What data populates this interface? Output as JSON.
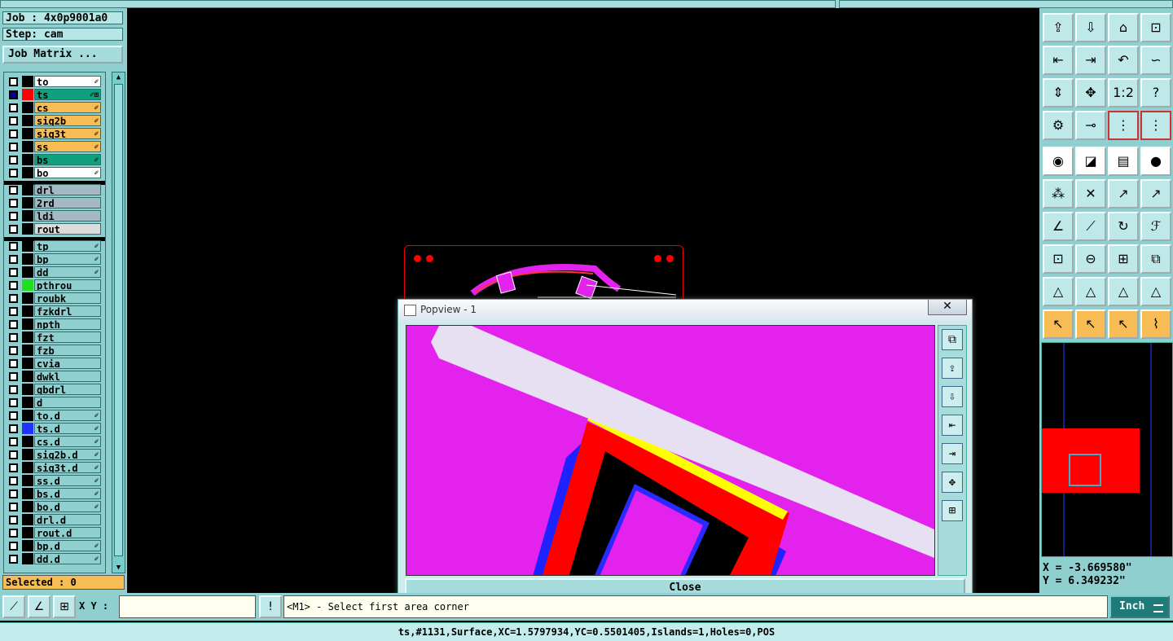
{
  "job_label": "Job : 4x0p9001a0",
  "step_label": "Step: cam",
  "job_matrix_button": "Job Matrix ...",
  "layers": [
    {
      "name": "to",
      "color": "#ffffff",
      "swatch": "#000000",
      "icon": "✐"
    },
    {
      "name": "ts",
      "color": "#0fa07e",
      "swatch": "#ff0000",
      "icon": "✐⊞",
      "checkbox_color": "#0000aa"
    },
    {
      "name": "cs",
      "color": "#f7bd54",
      "swatch": "#000000",
      "icon": "✐"
    },
    {
      "name": "sig2b",
      "color": "#f7bd54",
      "swatch": "#000000",
      "icon": "✐"
    },
    {
      "name": "sig3t",
      "color": "#f7bd54",
      "swatch": "#000000",
      "icon": "✐"
    },
    {
      "name": "ss",
      "color": "#f7bd54",
      "swatch": "#000000",
      "icon": "✐"
    },
    {
      "name": "bs",
      "color": "#0fa07e",
      "swatch": "#000000",
      "icon": "✐"
    },
    {
      "name": "bo",
      "color": "#ffffff",
      "swatch": "#000000",
      "icon": "✐"
    },
    {
      "name": "drl",
      "color": "#a5b9c4",
      "swatch": "#000000",
      "icon": ""
    },
    {
      "name": "2rd",
      "color": "#a5b9c4",
      "swatch": "#000000",
      "icon": ""
    },
    {
      "name": "ldi",
      "color": "#a5b9c4",
      "swatch": "#000000",
      "icon": ""
    },
    {
      "name": "rout",
      "color": "#dcdcdc",
      "swatch": "#000000",
      "icon": ""
    },
    {
      "name": "tp",
      "color": "#8fcfcf",
      "swatch": "#000000",
      "icon": "✐"
    },
    {
      "name": "bp",
      "color": "#8fcfcf",
      "swatch": "#000000",
      "icon": "✐"
    },
    {
      "name": "dd",
      "color": "#8fcfcf",
      "swatch": "#000000",
      "icon": "✐"
    },
    {
      "name": "pthrou",
      "color": "#8fcfcf",
      "swatch": "#22dd22",
      "icon": ""
    },
    {
      "name": "roubk",
      "color": "#8fcfcf",
      "swatch": "#000000",
      "icon": ""
    },
    {
      "name": "fzkdrl",
      "color": "#8fcfcf",
      "swatch": "#000000",
      "icon": ""
    },
    {
      "name": "npth",
      "color": "#8fcfcf",
      "swatch": "#000000",
      "icon": ""
    },
    {
      "name": "fzt",
      "color": "#8fcfcf",
      "swatch": "#000000",
      "icon": ""
    },
    {
      "name": "fzb",
      "color": "#8fcfcf",
      "swatch": "#000000",
      "icon": ""
    },
    {
      "name": "cvia",
      "color": "#8fcfcf",
      "swatch": "#000000",
      "icon": ""
    },
    {
      "name": "dwkl",
      "color": "#8fcfcf",
      "swatch": "#000000",
      "icon": ""
    },
    {
      "name": "gbdrl",
      "color": "#8fcfcf",
      "swatch": "#000000",
      "icon": ""
    },
    {
      "name": "d",
      "color": "#8fcfcf",
      "swatch": "#000000",
      "icon": ""
    },
    {
      "name": "to.d",
      "color": "#8fcfcf",
      "swatch": "#000000",
      "icon": "✐"
    },
    {
      "name": "ts.d",
      "color": "#8fcfcf",
      "swatch": "#2233ff",
      "icon": "✐"
    },
    {
      "name": "cs.d",
      "color": "#8fcfcf",
      "swatch": "#000000",
      "icon": "✐"
    },
    {
      "name": "sig2b.d",
      "color": "#8fcfcf",
      "swatch": "#000000",
      "icon": "✐"
    },
    {
      "name": "sig3t.d",
      "color": "#8fcfcf",
      "swatch": "#000000",
      "icon": "✐"
    },
    {
      "name": "ss.d",
      "color": "#8fcfcf",
      "swatch": "#000000",
      "icon": "✐"
    },
    {
      "name": "bs.d",
      "color": "#8fcfcf",
      "swatch": "#000000",
      "icon": "✐"
    },
    {
      "name": "bo.d",
      "color": "#8fcfcf",
      "swatch": "#000000",
      "icon": "✐"
    },
    {
      "name": "drl.d",
      "color": "#8fcfcf",
      "swatch": "#000000",
      "icon": ""
    },
    {
      "name": "rout.d",
      "color": "#8fcfcf",
      "swatch": "#000000",
      "icon": ""
    },
    {
      "name": "bp.d",
      "color": "#8fcfcf",
      "swatch": "#000000",
      "icon": "✐"
    },
    {
      "name": "dd.d",
      "color": "#8fcfcf",
      "swatch": "#000000",
      "icon": "✐"
    }
  ],
  "selected_label": "Selected : 0",
  "popview": {
    "title": "Popview - 1",
    "close_x": "✕",
    "close_button": "Close"
  },
  "toolbar_icons": [
    "⇪",
    "⇩",
    "⌂",
    "⊡",
    "⇤",
    "⇥",
    "↶",
    "∽",
    "⇕",
    "✥",
    "1:2",
    "?",
    "⚙",
    "⊸",
    "⋮",
    "⋮",
    "◉",
    "◪",
    "▤",
    "●",
    "⁂",
    "✕",
    "↗",
    "↗",
    "∠",
    "⟋",
    "↻",
    "ℱ",
    "⊡",
    "⊖",
    "⊞",
    "⧉",
    "△",
    "△",
    "△",
    "△",
    "↖",
    "↖",
    "↖",
    "⌇"
  ],
  "coords": {
    "x": "X = -3.669580\"",
    "y": "Y = 6.349232\""
  },
  "xy_label": "X Y :",
  "xy_value": "",
  "prompt_text": "<M1> - Select first area corner",
  "units": "Inch",
  "status_text": "ts,#1131,Surface,XC=1.5797934,YC=0.5501405,Islands=1,Holes=0,POS"
}
